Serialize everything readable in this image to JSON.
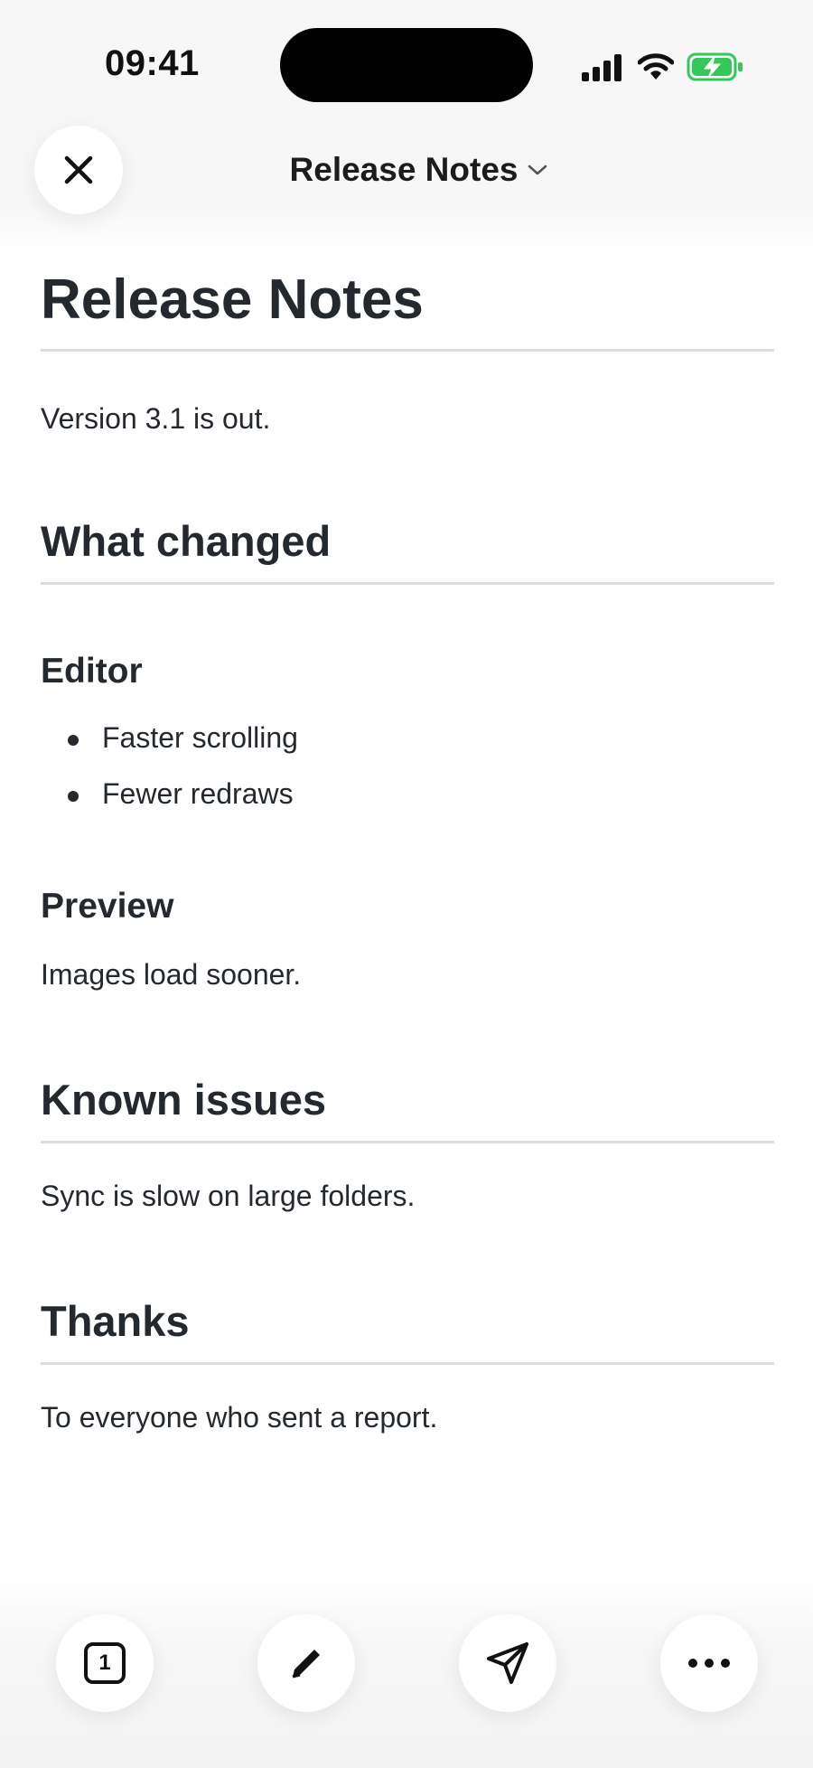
{
  "status_bar": {
    "time": "09:41"
  },
  "nav": {
    "title": "Release Notes"
  },
  "document": {
    "title": "Release Notes",
    "intro": "Version 3.1 is out.",
    "sections": [
      {
        "heading": "What changed",
        "subsections": [
          {
            "heading": "Editor",
            "items": [
              "Faster scrolling",
              "Fewer redraws"
            ]
          },
          {
            "heading": "Preview",
            "text": "Images load sooner."
          }
        ]
      },
      {
        "heading": "Known issues",
        "text": "Sync is slow on large folders."
      },
      {
        "heading": "Thanks",
        "text": "To everyone who sent a report."
      }
    ]
  },
  "toolbar": {
    "tabs_count": "1",
    "icons": [
      "tabs-icon",
      "edit-icon",
      "share-icon",
      "more-icon"
    ]
  },
  "colors": {
    "text": "#24292f",
    "rule": "#d8dee4",
    "battery": "#34c759"
  }
}
